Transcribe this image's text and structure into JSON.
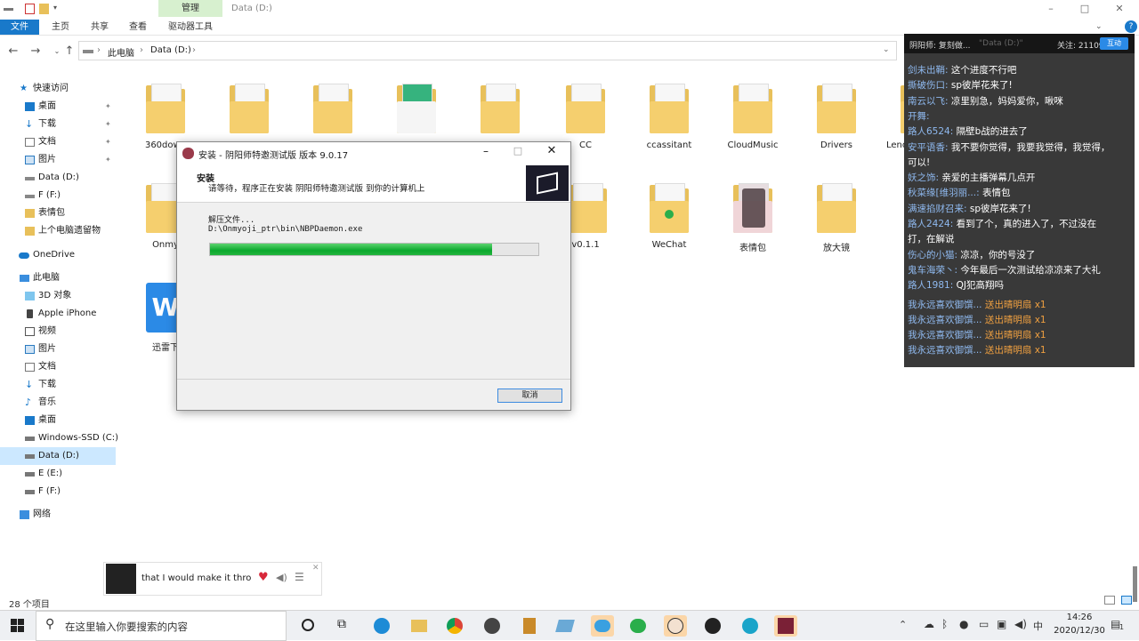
{
  "window": {
    "title": "Data (D:)",
    "contextual_tab": "管理",
    "controls": [
      "–",
      "□",
      "✕"
    ]
  },
  "ribbon": {
    "tabs": [
      "文件",
      "主页",
      "共享",
      "查看",
      "驱动器工具"
    ]
  },
  "address": {
    "crumbs": [
      "此电脑",
      "Data (D:)"
    ]
  },
  "nav_pane": {
    "quick_access": "快速访问",
    "quick_items": [
      "桌面",
      "下载",
      "文档",
      "图片",
      "Data (D:)",
      "F (F:)",
      "表情包",
      "上个电脑遗留物"
    ],
    "onedrive": "OneDrive",
    "this_pc": "此电脑",
    "pc_items": [
      "3D 对象",
      "Apple iPhone",
      "视频",
      "图片",
      "文档",
      "下载",
      "音乐",
      "桌面",
      "Windows-SSD (C:)",
      "Data (D:)",
      "E (E:)",
      "F (F:)"
    ],
    "network": "网络"
  },
  "files": {
    "row1": [
      "360down",
      "",
      "",
      "",
      "",
      "CC",
      "ccassitant",
      "CloudMusic",
      "Drivers",
      "Leno"
    ],
    "row2": [
      "Onmy",
      "",
      "",
      "",
      "v0.1.1",
      "WeChat",
      "表情包",
      "放大镜"
    ],
    "row3": [
      "迅雷下"
    ]
  },
  "status": {
    "count": "28 个项目"
  },
  "dialog": {
    "title": "安装 - 阴阳师特邀测试版 版本 9.0.17",
    "heading": "安装",
    "subheading": "请等待，程序正在安装 阴阳师特邀测试版 到你的计算机上",
    "status_line": "解压文件...",
    "path": "D:\\Onmyoji_ptr\\bin\\NBPDaemon.exe",
    "progress": 0.86,
    "cancel": "取消"
  },
  "chat": {
    "header": "阴阳师: 复刻做...",
    "follow": "关注: 211093",
    "interact": "互动",
    "location": "\"Data (D:)\"",
    "lines": [
      {
        "user": "剑未出鞘:",
        "text": "这个进度不行吧"
      },
      {
        "user": "撕破伤口:",
        "text": "sp彼岸花来了!"
      },
      {
        "user": "南云以飞:",
        "text": "凉里别急，妈妈爱你，啾咪"
      },
      {
        "user": "开舞:",
        "text": ""
      },
      {
        "user": "路人6524:",
        "text": "隔壁b战的进去了"
      },
      {
        "user": "安平语香:",
        "text": "我不要你觉得，我要我觉得，我觉得，"
      },
      {
        "user": "",
        "text": "可以!"
      },
      {
        "user": "妖之饰:",
        "text": "亲爱的主播弹幕几点开"
      },
      {
        "user": "秋菜缘[维羽丽...:",
        "text": "表情包"
      },
      {
        "user": "满速掐财召来:",
        "text": "sp彼岸花来了!"
      },
      {
        "user": "路人2424:",
        "text": "看到了个，真的进入了，不过没在"
      },
      {
        "user": "",
        "text": "打，在解说"
      },
      {
        "user": "伤心的小猫:",
        "text": "凉凉，你的号没了"
      },
      {
        "user": "鬼车海荣丶:",
        "text": "今年最后一次测试给凉凉来了大礼"
      },
      {
        "user": "路人1981:",
        "text": "QJ犯高翔吗"
      }
    ],
    "gifts": [
      {
        "user": "我永远喜欢御馔...",
        "gift": "送出晴明扇",
        "count": "x1"
      },
      {
        "user": "我永远喜欢御馔...",
        "gift": "送出晴明扇",
        "count": "x1"
      },
      {
        "user": "我永远喜欢御馔...",
        "gift": "送出晴明扇",
        "count": "x1"
      },
      {
        "user": "我永远喜欢御馔...",
        "gift": "送出晴明扇",
        "count": "x1"
      }
    ]
  },
  "music": {
    "lyric": "that I would make it thro"
  },
  "taskbar": {
    "search_placeholder": "在这里输入你要搜索的内容",
    "time": "14:26",
    "date": "2020/12/30",
    "ime": "中",
    "notif": "1"
  },
  "colors": {
    "accent": "#1979ca",
    "progress": "#0aa82d",
    "folder": "#e8c05a",
    "chat_user": "#8fb9ef",
    "gift": "#f0a040"
  }
}
